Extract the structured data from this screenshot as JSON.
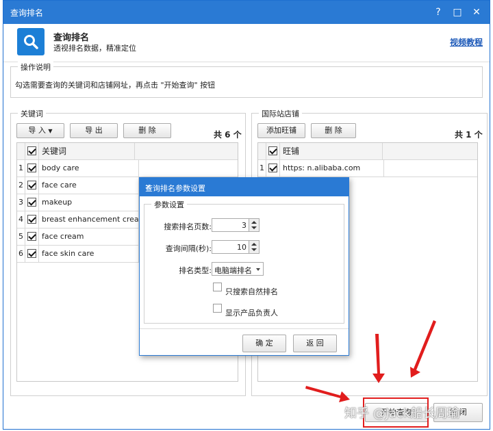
{
  "window": {
    "title": "查询排名",
    "controls": [
      "?",
      "□",
      "✕"
    ]
  },
  "header": {
    "title": "查询排名",
    "subtitle": "透视排名数据，精准定位",
    "video_link": "视频教程",
    "icon": "search-icon",
    "accent": "#2a7ad4"
  },
  "instructions": {
    "legend": "操作说明",
    "text": "勾选需要查询的关键词和店铺网址，再点击 \"开始查询\" 按钮"
  },
  "keywords": {
    "legend": "关键词",
    "buttons": {
      "import": "导 入",
      "export": "导 出",
      "delete": "删 除"
    },
    "count": "共 6 个",
    "column": "关键词",
    "rows": [
      {
        "n": "1",
        "text": "body care"
      },
      {
        "n": "2",
        "text": "face care"
      },
      {
        "n": "3",
        "text": "makeup"
      },
      {
        "n": "4",
        "text": "breast enhancement cream"
      },
      {
        "n": "5",
        "text": "face cream"
      },
      {
        "n": "6",
        "text": "face skin care"
      }
    ]
  },
  "shops": {
    "legend": "国际站店铺",
    "buttons": {
      "add": "添加旺铺",
      "delete": "删 除"
    },
    "count": "共 1 个",
    "column": "旺铺",
    "rows": [
      {
        "n": "1",
        "text": "https:              n.alibaba.com"
      }
    ]
  },
  "dialog": {
    "title": "查询排名参数设置",
    "group": "参数设置",
    "pages_label": "搜索排名页数:",
    "pages_value": "3",
    "interval_label": "查询间隔(秒):",
    "interval_value": "10",
    "type_label": "排名类型:",
    "type_value": "电脑端排名",
    "natural_only": "只搜索自然排名",
    "show_owner": "显示产品负责人",
    "ok": "确 定",
    "back": "返 回"
  },
  "footer": {
    "start": "开始查询",
    "close": "关 闭"
  },
  "watermark": "知乎 @Jack船长周瑜",
  "highlight_color": "#e11d1d"
}
